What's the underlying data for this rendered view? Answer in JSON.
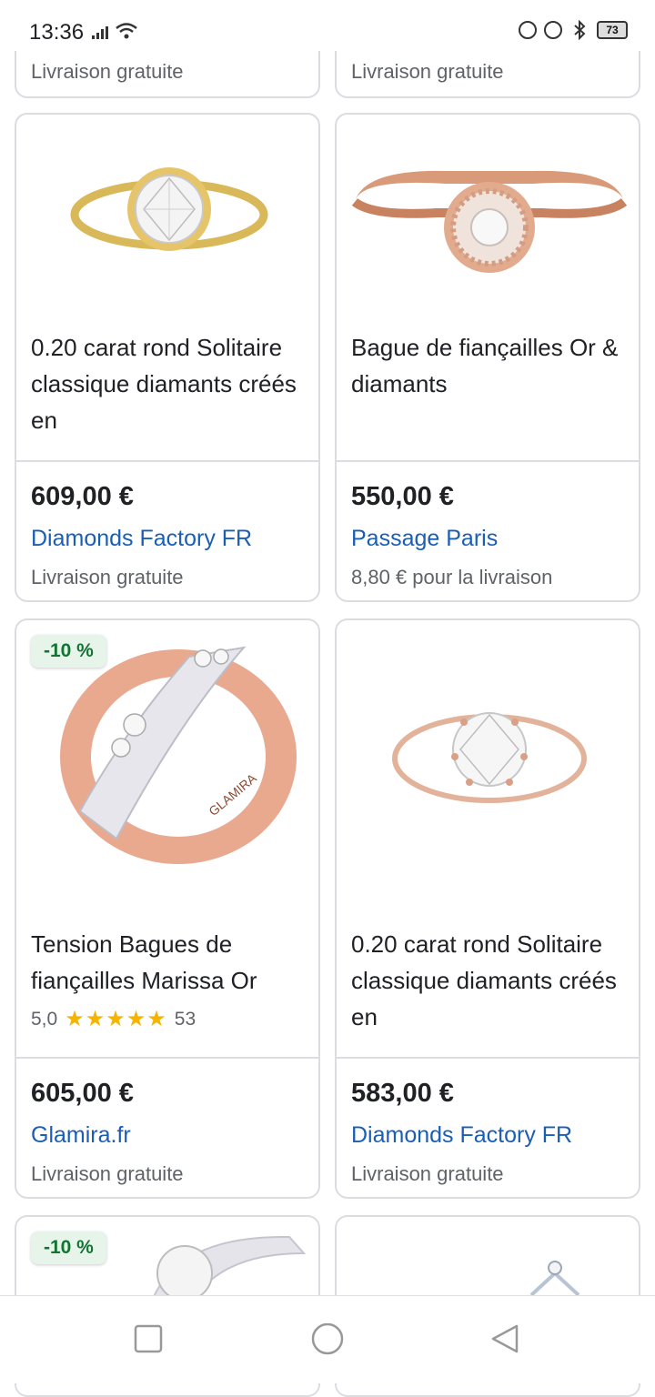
{
  "status_bar": {
    "time": "13:36",
    "battery": "73"
  },
  "top_partial": [
    {
      "shipping": "Livraison gratuite"
    },
    {
      "shipping": "Livraison gratuite"
    }
  ],
  "products": [
    {
      "title": "0.20 carat rond Solitaire classique diamants créés en",
      "price": "609,00 €",
      "seller": "Diamonds Factory FR",
      "shipping": "Livraison gratuite"
    },
    {
      "title": "Bague de fiançailles Or & diamants",
      "price": "550,00 €",
      "seller": "Passage Paris",
      "shipping": "8,80 € pour la livraison"
    },
    {
      "badge": "-10 %",
      "brand_engraving": "GLAMIRA",
      "title": "Tension Bagues de fiançailles Marissa Or",
      "rating": "5,0",
      "stars": "★★★★★",
      "reviews": "53",
      "price": "605,00 €",
      "seller": "Glamira.fr",
      "shipping": "Livraison gratuite"
    },
    {
      "title": "0.20 carat rond Solitaire classique diamants créés en",
      "price": "583,00 €",
      "seller": "Diamonds Factory FR",
      "shipping": "Livraison gratuite"
    }
  ],
  "bottom_partial": [
    {
      "badge": "-10 %"
    },
    {}
  ],
  "colors": {
    "seller_link": "#1a5fb4",
    "badge_bg": "#e6f4ea",
    "badge_text": "#137333",
    "star": "#f5b400"
  },
  "nav": [
    "square-nav-icon",
    "circle-home-icon",
    "triangle-back-icon"
  ]
}
